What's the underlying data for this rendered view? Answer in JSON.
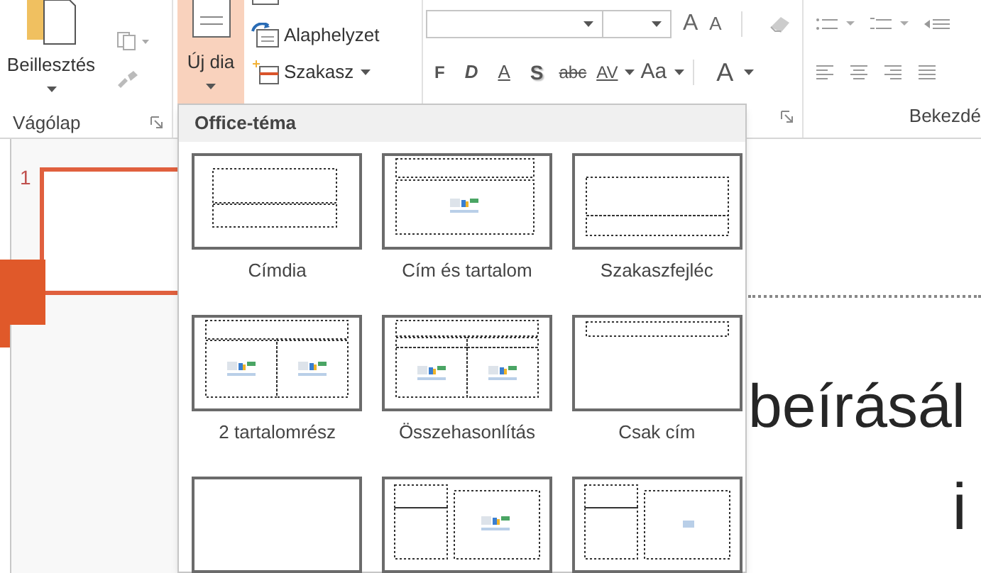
{
  "ribbon": {
    "clipboard": {
      "paste_label": "Beillesztés",
      "group_label": "Vágólap"
    },
    "slides": {
      "new_slide": {
        "label": "Új dia",
        "expanded": true
      },
      "commands": [
        {
          "kind": "layout"
        },
        {
          "kind": "reset",
          "label": "Alaphelyzet"
        },
        {
          "kind": "section",
          "label": "Szakasz",
          "dropdown": true
        }
      ]
    },
    "font": {
      "size_buttons": [
        {
          "text": "A",
          "kind": "grow"
        },
        {
          "text": "A",
          "kind": "shrink"
        }
      ],
      "buttons": [
        {
          "text": "F",
          "kind": "bold"
        },
        {
          "text": "D",
          "kind": "italic"
        },
        {
          "text": "A",
          "kind": "underline"
        },
        {
          "text": "S",
          "kind": "shadow"
        },
        {
          "text": "abc",
          "kind": "strike"
        },
        {
          "text": "AV",
          "kind": "spacing",
          "dropdown": true
        },
        {
          "text": "Aa",
          "kind": "case",
          "dropdown": true
        },
        {
          "text": "A",
          "kind": "color",
          "dropdown": true
        }
      ]
    },
    "paragraph": {
      "group_label": "Bekezdé"
    }
  },
  "slide_panel": {
    "thumbnails": [
      {
        "number": "1",
        "selected": true
      }
    ]
  },
  "layout_gallery": {
    "title": "Office-téma",
    "layouts": [
      {
        "label": "Címdia",
        "kind": "title"
      },
      {
        "label": "Cím és tartalom",
        "kind": "title_content"
      },
      {
        "label": "Szakaszfejléc",
        "kind": "section"
      },
      {
        "label": "2 tartalomrész",
        "kind": "two_content"
      },
      {
        "label": "Összehasonlítás",
        "kind": "comparison"
      },
      {
        "label": "Csak cím",
        "kind": "title_only"
      },
      {
        "kind": "blank"
      },
      {
        "kind": "content_caption"
      },
      {
        "kind": "picture_caption"
      }
    ]
  },
  "slide": {
    "text_lines": [
      "beírásál",
      "i"
    ]
  }
}
